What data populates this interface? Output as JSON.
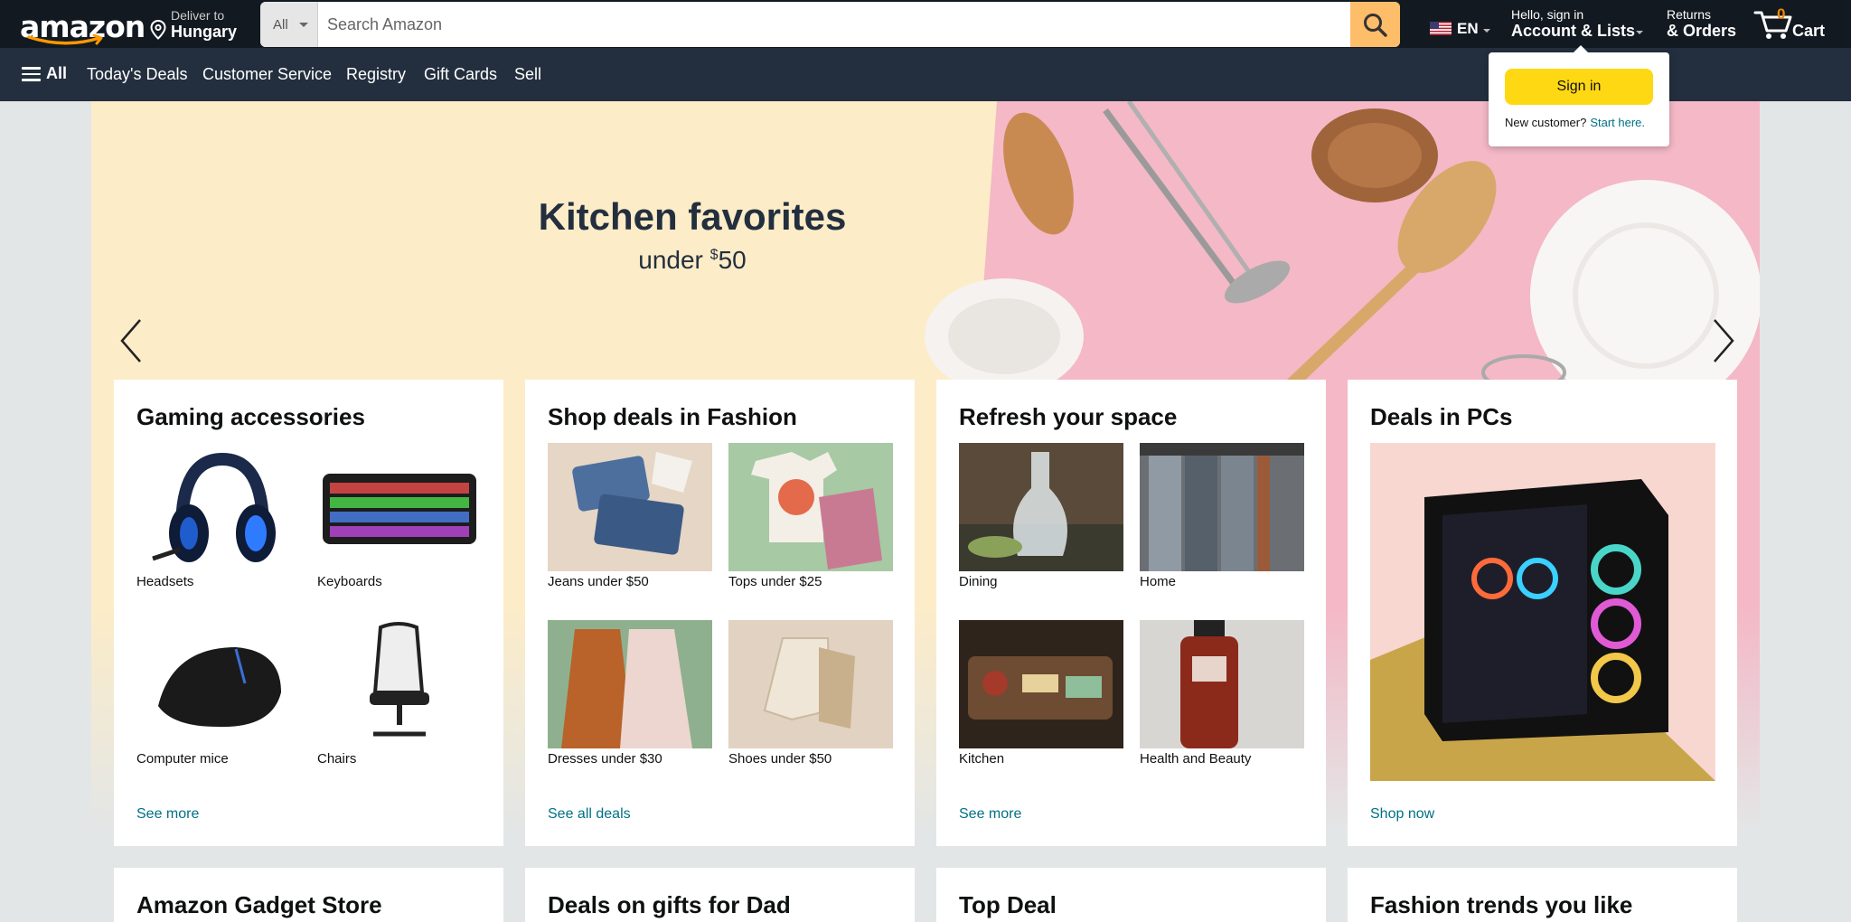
{
  "header": {
    "logo_text": "amazon",
    "deliver_to": "Deliver to",
    "deliver_location": "Hungary",
    "search_category": "All",
    "search_placeholder": "Search Amazon",
    "language": "EN",
    "account_greeting": "Hello, sign in",
    "account_label": "Account & Lists",
    "returns_line1": "Returns",
    "returns_line2": "& Orders",
    "cart_count": "0",
    "cart_label": "Cart"
  },
  "nav": {
    "all_label": "All",
    "items": [
      "Today's Deals",
      "Customer Service",
      "Registry",
      "Gift Cards",
      "Sell"
    ]
  },
  "flyout": {
    "sign_in_button": "Sign in",
    "new_customer": "New customer?",
    "start_here": "Start here."
  },
  "hero": {
    "title": "Kitchen favorites",
    "subtitle_prefix": "under ",
    "subtitle_currency": "$",
    "subtitle_amount": "50"
  },
  "cards": [
    {
      "title": "Gaming accessories",
      "tiles": [
        "Headsets",
        "Keyboards",
        "Computer mice",
        "Chairs"
      ],
      "link": "See more"
    },
    {
      "title": "Shop deals in Fashion",
      "tiles": [
        "Jeans under $50",
        "Tops under $25",
        "Dresses under $30",
        "Shoes under $50"
      ],
      "link": "See all deals"
    },
    {
      "title": "Refresh your space",
      "tiles": [
        "Dining",
        "Home",
        "Kitchen",
        "Health and Beauty"
      ],
      "link": "See more"
    },
    {
      "title": "Deals in PCs",
      "link": "Shop now"
    }
  ],
  "bottom_cards": [
    "Amazon Gadget Store",
    "Deals on gifts for Dad",
    "Top Deal",
    "Fashion trends you like"
  ],
  "colors": {
    "topbar": "#131921",
    "navbar": "#232f3e",
    "search_button": "#febd69",
    "sign_in_button": "#ffd814",
    "link": "#007185",
    "cart_count": "#f08804"
  }
}
